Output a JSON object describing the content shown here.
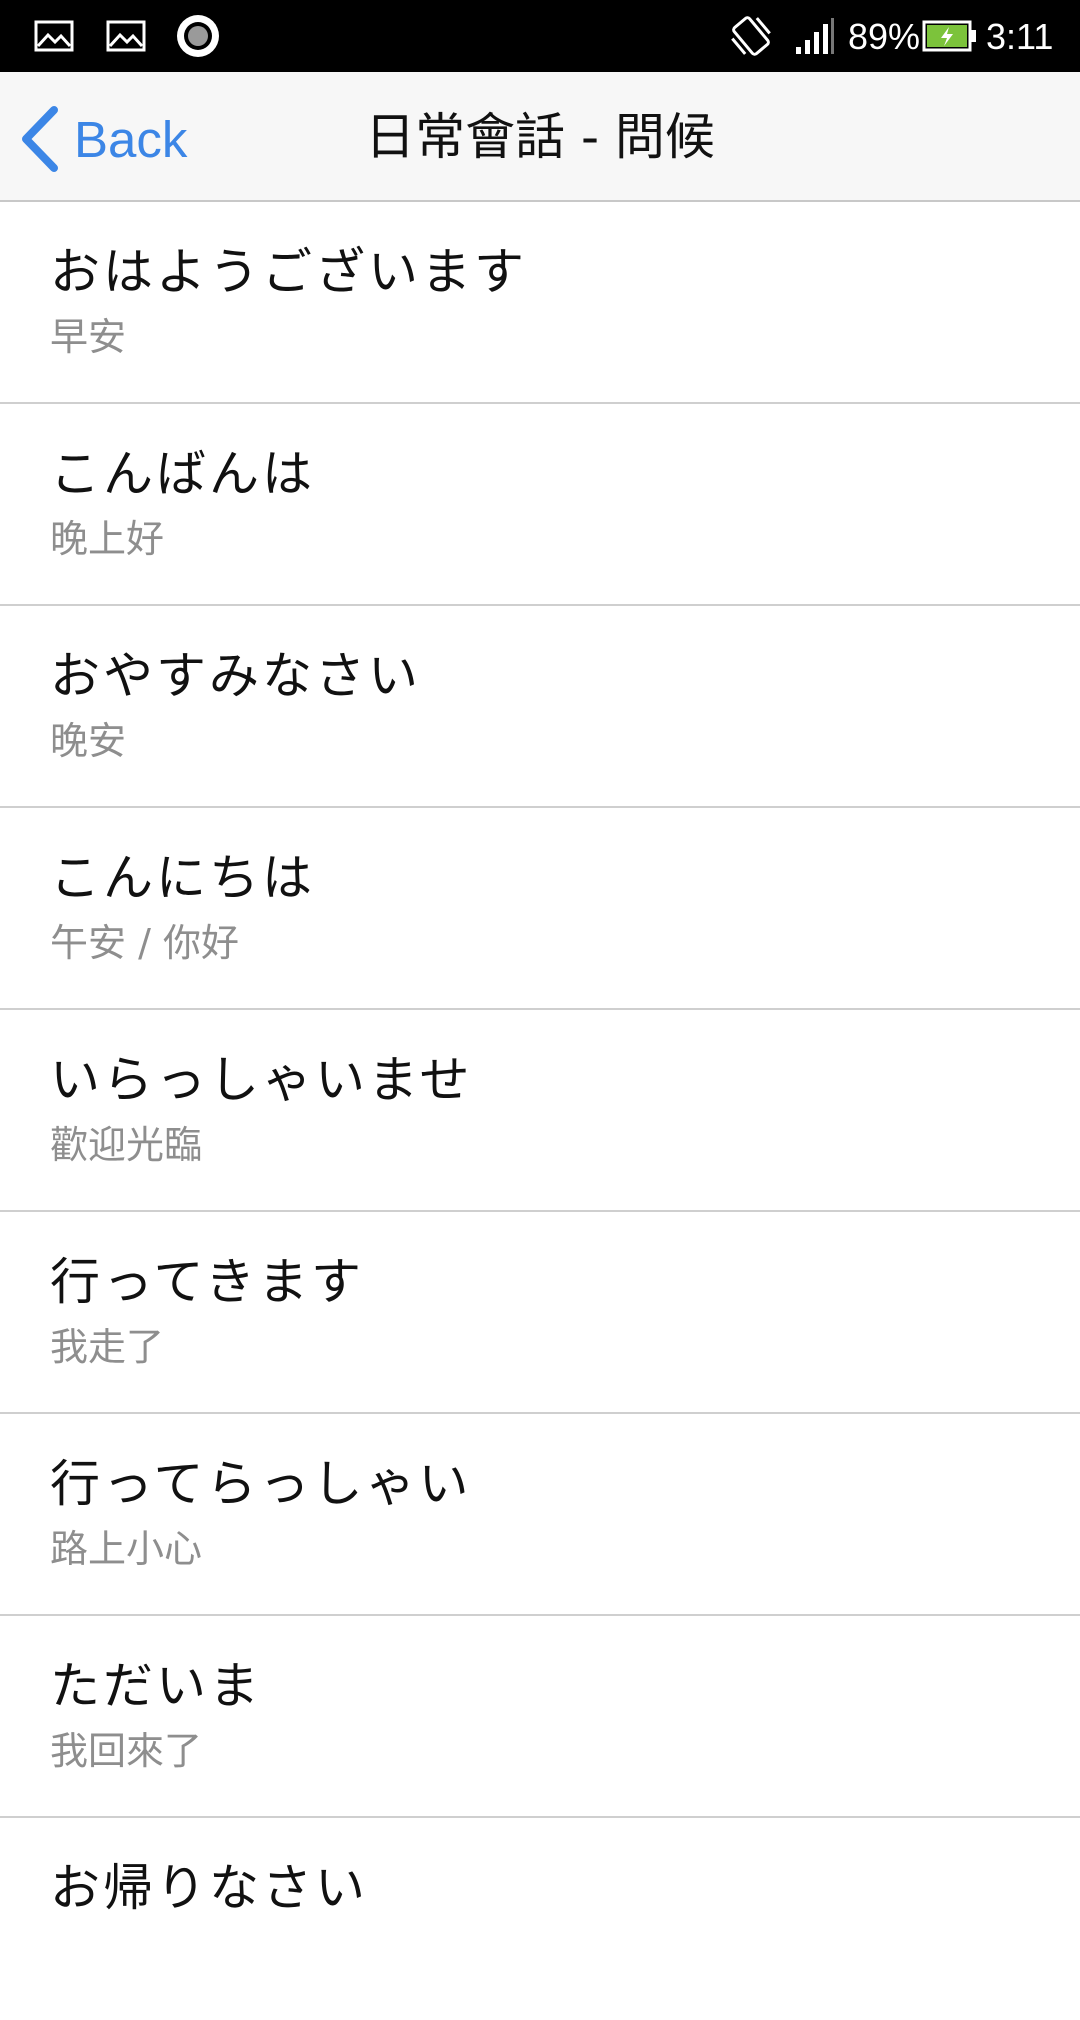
{
  "status_bar": {
    "notification_icons": [
      "image-icon",
      "image-icon",
      "record-icon"
    ],
    "vibrate_icon": "vibrate-icon",
    "signal_icon": "signal-icon",
    "battery_percent": "89%",
    "battery_level": 0.89,
    "battery_charging": true,
    "time": "3:11"
  },
  "nav": {
    "back_label": "Back",
    "title": "日常會話 - 問候",
    "accent_color": "#3c86e6"
  },
  "phrases": [
    {
      "ja": "おはようございます",
      "zh": "早安"
    },
    {
      "ja": "こんばんは",
      "zh": "晚上好"
    },
    {
      "ja": "おやすみなさい",
      "zh": "晚安"
    },
    {
      "ja": "こんにちは",
      "zh": "午安 / 你好"
    },
    {
      "ja": "いらっしゃいませ",
      "zh": "歡迎光臨"
    },
    {
      "ja": "行ってきます",
      "zh": "我走了"
    },
    {
      "ja": "行ってらっしゃい",
      "zh": "路上小心"
    },
    {
      "ja": "ただいま",
      "zh": "我回來了"
    },
    {
      "ja": "お帰りなさい",
      "zh": ""
    }
  ]
}
